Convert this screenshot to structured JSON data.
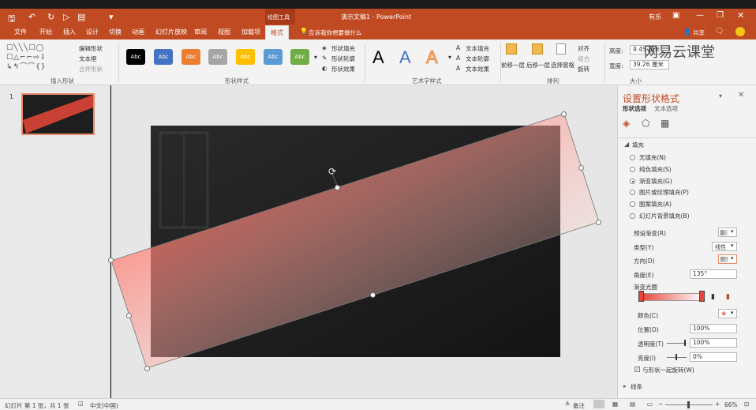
{
  "titlebar": {
    "context_tab": "绘图工具",
    "title": "演示文稿1 - PowerPoint",
    "user": "有乐"
  },
  "tabs": [
    "文件",
    "开始",
    "插入",
    "设计",
    "切换",
    "动画",
    "幻灯片放映",
    "审阅",
    "视图",
    "加载项",
    "格式"
  ],
  "tell_me": "告诉我你想要做什么",
  "share": "共享",
  "ribbon": {
    "insert_shapes": {
      "label": "插入形状",
      "edit_shape": "编辑形状",
      "text_box": "文本框",
      "merge_shapes": "合并形状"
    },
    "shape_styles": {
      "label": "形状样式",
      "sample": "Abc",
      "swatches": [
        "#000000",
        "#4472c4",
        "#ed7d31",
        "#a5a5a5",
        "#ffc000",
        "#5b9bd5",
        "#70ad47"
      ],
      "fill": "形状填充",
      "outline": "形状轮廓",
      "effects": "形状效果"
    },
    "wordart": {
      "label": "艺术字样式",
      "letter": "A",
      "text_fill": "文本填充",
      "text_outline": "文本轮廓",
      "text_effects": "文本效果"
    },
    "arrange": {
      "label": "排列",
      "bring_forward": "前移一层",
      "send_backward": "后移一层",
      "selection_pane": "选择窗格",
      "align": "对齐",
      "group": "组合",
      "rotate": "旋转"
    },
    "size": {
      "label": "大小",
      "height_label": "高度:",
      "height_value": "9.45 厘米",
      "width_label": "宽度:",
      "width_value": "39.26 厘米"
    },
    "watermark": "网易云课堂"
  },
  "slides": {
    "number": "1"
  },
  "pane": {
    "title": "设置形状格式",
    "tab_shape": "形状选项",
    "tab_text": "文本选项",
    "fill_section": "填充",
    "options": [
      {
        "label": "无填充(N)",
        "selected": false
      },
      {
        "label": "纯色填充(S)",
        "selected": false
      },
      {
        "label": "渐变填充(G)",
        "selected": true
      },
      {
        "label": "图片或纹理填充(P)",
        "selected": false
      },
      {
        "label": "图案填充(A)",
        "selected": false
      },
      {
        "label": "幻灯片背景填充(B)",
        "selected": false
      }
    ],
    "preset_gradient": "预设渐变(R)",
    "type_label": "类型(Y)",
    "type_value": "线性",
    "direction_label": "方向(D)",
    "angle_label": "角度(E)",
    "angle_value": "135°",
    "stops_label": "渐变光圈",
    "color_label": "颜色(C)",
    "position_label": "位置(O)",
    "position_value": "100%",
    "transparency_label": "透明度(T)",
    "transparency_value": "100%",
    "brightness_label": "亮度(I)",
    "brightness_value": "0%",
    "rotate_with_shape": "与形状一起旋转(W)",
    "line_section": "线条",
    "gradient_start": "#e8463a",
    "gradient_end": "#ffffff"
  },
  "status": {
    "slide_info": "幻灯片 第 1 张，共 1 张",
    "language": "中文(中国)",
    "notes": "备注",
    "zoom": "66%"
  }
}
